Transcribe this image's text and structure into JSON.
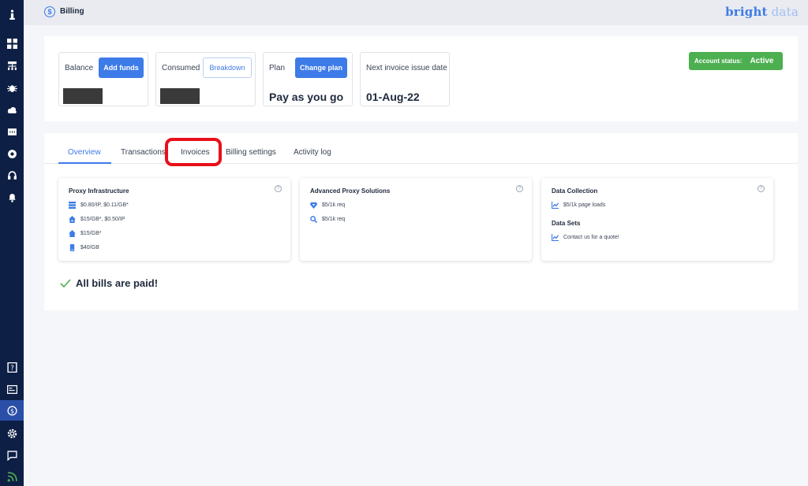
{
  "header": {
    "page_title": "Billing",
    "brand_primary": "bright",
    "brand_secondary": "data"
  },
  "sidebar": {
    "items": [
      {
        "icon": "info-icon"
      },
      {
        "icon": "dashboard-icon"
      },
      {
        "icon": "proxy-network-icon"
      },
      {
        "icon": "bug-icon"
      },
      {
        "icon": "cloud-icon"
      },
      {
        "icon": "api-icon"
      },
      {
        "icon": "browser-icon"
      },
      {
        "icon": "support-icon"
      },
      {
        "icon": "bell-icon"
      },
      {
        "icon": "help-book-icon"
      },
      {
        "icon": "id-card-icon"
      },
      {
        "icon": "billing-icon",
        "active": true
      },
      {
        "icon": "settings-icon"
      },
      {
        "icon": "chat-icon"
      },
      {
        "icon": "rss-icon"
      }
    ]
  },
  "summary": {
    "balance": {
      "label": "Balance",
      "button": "Add funds"
    },
    "consumed": {
      "label": "Consumed",
      "button": "Breakdown"
    },
    "plan": {
      "label": "Plan",
      "button": "Change plan",
      "value": "Pay as you go"
    },
    "next_invoice": {
      "label": "Next invoice issue date",
      "value": "01-Aug-22"
    },
    "account_status": {
      "label": "Account status:",
      "value": "Active"
    }
  },
  "tabs": [
    {
      "label": "Overview",
      "active": true
    },
    {
      "label": "Transactions"
    },
    {
      "label": "Invoices",
      "highlighted": true
    },
    {
      "label": "Billing settings"
    },
    {
      "label": "Activity log"
    }
  ],
  "cards": {
    "proxy_infrastructure": {
      "title": "Proxy Infrastructure",
      "rows": [
        {
          "icon": "datacenter-icon",
          "text": "$0.80/IP, $0.11/GB*"
        },
        {
          "icon": "residential-icon",
          "text": "$15/GB*, $0.50/IP"
        },
        {
          "icon": "home-icon",
          "text": "$15/GB*"
        },
        {
          "icon": "mobile-icon",
          "text": "$40/GB"
        }
      ]
    },
    "advanced_proxy": {
      "title": "Advanced Proxy Solutions",
      "rows": [
        {
          "icon": "unblocker-icon",
          "text": "$5/1k req"
        },
        {
          "icon": "search-icon",
          "text": "$5/1k req"
        }
      ]
    },
    "data_collection": {
      "title": "Data Collection",
      "rows": [
        {
          "icon": "chart-icon",
          "text": "$5/1k page loads"
        }
      ],
      "subtitle": "Data Sets",
      "sub_rows": [
        {
          "icon": "chart-icon",
          "text": "Contact us for a quote!"
        }
      ]
    }
  },
  "bills_status": "All bills are paid!",
  "colors": {
    "accent": "#3d7be8",
    "sidebar": "#0e1f45",
    "success": "#4caf50",
    "highlight": "#e8101a"
  }
}
